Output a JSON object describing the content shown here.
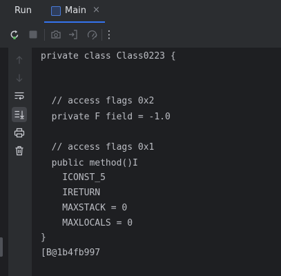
{
  "tool_window": {
    "title": "Run"
  },
  "tab": {
    "label": "Main",
    "close_glyph": "×",
    "icon": "application-icon",
    "accent_color": "#3574f0"
  },
  "toolbar": {
    "icons": [
      "rerun-icon",
      "stop-icon",
      "camera-icon",
      "exit-icon",
      "settings-icon",
      "more-icon"
    ],
    "more_glyph": "⋮"
  },
  "gutter": {
    "icons": [
      "arrow-up-icon",
      "arrow-down-icon",
      "soft-wrap-icon",
      "scroll-to-end-icon",
      "print-icon",
      "trash-icon"
    ]
  },
  "console": {
    "lines": [
      "private class Class0223 {",
      "",
      "",
      "  // access flags 0x2",
      "  private F field = -1.0",
      "",
      "  // access flags 0x1",
      "  public method()I",
      "    ICONST_5",
      "    IRETURN",
      "    MAXSTACK = 0",
      "    MAXLOCALS = 0",
      "}",
      "[B@1b4fb997"
    ]
  }
}
